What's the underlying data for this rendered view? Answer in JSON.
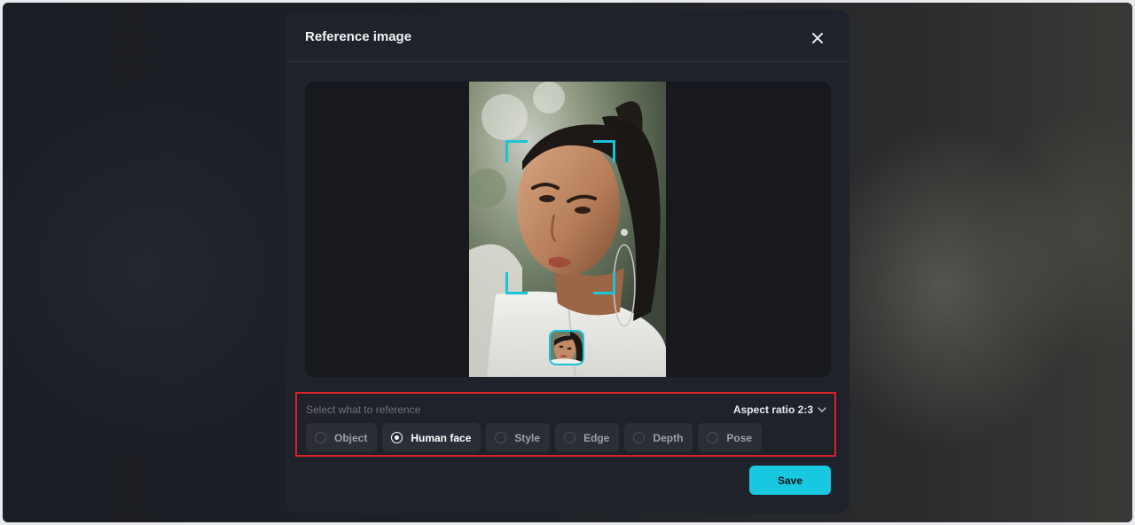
{
  "modal": {
    "title": "Reference image",
    "close_icon": "close-icon"
  },
  "reference": {
    "label": "Select what to reference",
    "aspect_ratio_label": "Aspect ratio 2:3",
    "options": [
      {
        "label": "Object",
        "selected": false
      },
      {
        "label": "Human face",
        "selected": true
      },
      {
        "label": "Style",
        "selected": false
      },
      {
        "label": "Edge",
        "selected": false
      },
      {
        "label": "Depth",
        "selected": false
      },
      {
        "label": "Pose",
        "selected": false
      }
    ]
  },
  "actions": {
    "save_label": "Save"
  },
  "colors": {
    "accent": "#17c8e0",
    "highlight_border": "#d8222a",
    "modal_bg": "#1f222a"
  }
}
